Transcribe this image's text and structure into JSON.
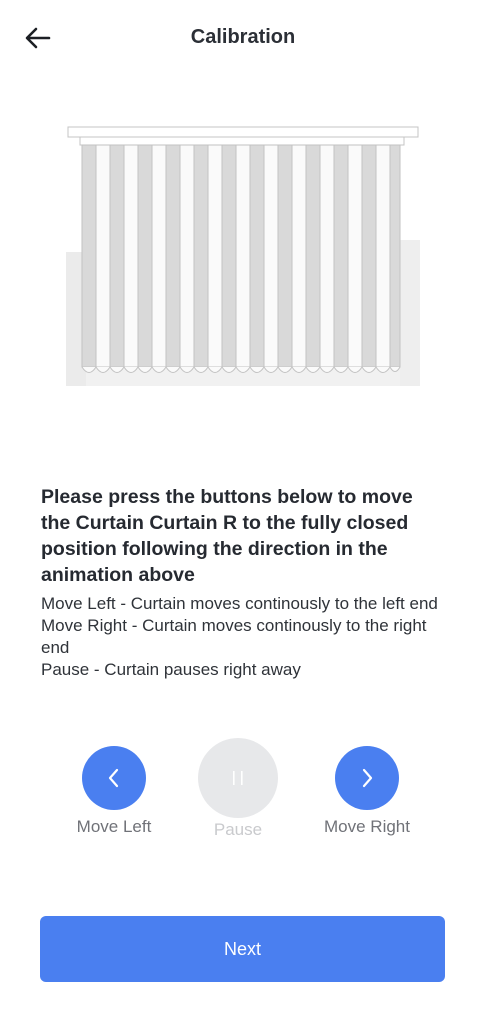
{
  "header": {
    "title": "Calibration",
    "back_icon": "arrow-left-icon"
  },
  "instructions": {
    "headline": "Please press the buttons below to move the Curtain Curtain R to the fully closed position following the direction in the animation above",
    "lines": [
      "Move Left - Curtain moves continously to the left end",
      "Move Right - Curtain moves continously to the right end",
      "Pause - Curtain pauses right away"
    ]
  },
  "controls": {
    "move_left": {
      "label": "Move Left",
      "icon": "chevron-left-icon"
    },
    "pause": {
      "label": "Pause",
      "icon": "pause-icon",
      "enabled": false
    },
    "move_right": {
      "label": "Move Right",
      "icon": "chevron-right-icon"
    }
  },
  "footer": {
    "next_label": "Next"
  },
  "colors": {
    "accent": "#4a7ff0",
    "disabled": "#e7e8ea",
    "text": "#262a31"
  }
}
